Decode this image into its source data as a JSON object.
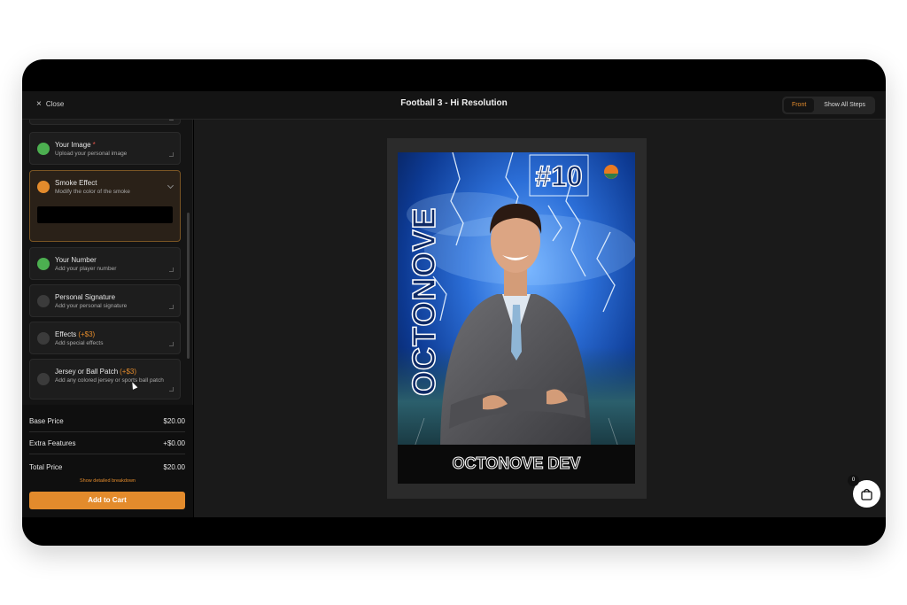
{
  "header": {
    "close_label": "Close",
    "title": "Football 3 - Hi Resolution",
    "view_tabs": [
      {
        "label": "Front",
        "active": true
      },
      {
        "label": "Show All Steps",
        "active": false
      }
    ]
  },
  "steps": [
    {
      "name": "Your Image",
      "required_mark": "*",
      "extra": "",
      "description": "Upload your personal image",
      "status": "complete"
    },
    {
      "name": "Smoke Effect",
      "required_mark": "",
      "extra": "",
      "description": "Modify the color of the smoke",
      "status": "in-progress",
      "expanded": true,
      "selected_color": "#000000"
    },
    {
      "name": "Your Number",
      "required_mark": "",
      "extra": "",
      "description": "Add your player number",
      "status": "complete"
    },
    {
      "name": "Personal Signature",
      "required_mark": "",
      "extra": "",
      "description": "Add your personal signature",
      "status": "pending"
    },
    {
      "name": "Effects",
      "required_mark": "",
      "extra": "(+$3)",
      "description": "Add special effects",
      "status": "pending"
    },
    {
      "name": "Jersey or Ball Patch",
      "required_mark": "",
      "extra": "(+$3)",
      "description": "Add any colored jersey or sports ball patch",
      "status": "pending"
    }
  ],
  "pricing": {
    "base_label": "Base Price",
    "base_value": "$20.00",
    "extra_label": "Extra Features",
    "extra_value": "+$0.00",
    "total_label": "Total Price",
    "total_value": "$20.00",
    "breakdown_link": "Show detailed breakdown",
    "cart_button": "Add to Cart"
  },
  "card": {
    "number": "#10",
    "vertical_name": "OCTONOVE",
    "bottom_name": "OCTONOVE DEV"
  },
  "cart": {
    "count": "0"
  },
  "colors": {
    "accent": "#e38b2c",
    "complete": "#4caf50",
    "background": "#141414"
  }
}
